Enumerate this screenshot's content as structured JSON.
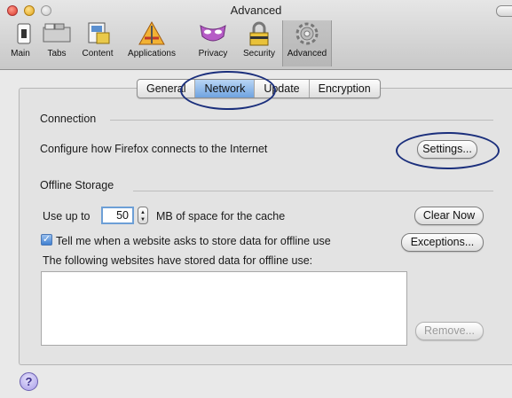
{
  "window": {
    "title": "Advanced"
  },
  "toolbar": {
    "items": [
      {
        "label": "Main",
        "icon": "main-switch-icon"
      },
      {
        "label": "Tabs",
        "icon": "tabs-icon"
      },
      {
        "label": "Content",
        "icon": "content-icon"
      },
      {
        "label": "Applications",
        "icon": "applications-icon"
      },
      {
        "label": "Privacy",
        "icon": "privacy-mask-icon"
      },
      {
        "label": "Security",
        "icon": "security-padlock-icon"
      },
      {
        "label": "Advanced",
        "icon": "advanced-gear-icon"
      }
    ],
    "selected": "Advanced"
  },
  "tabs": [
    {
      "label": "General"
    },
    {
      "label": "Network",
      "active": true
    },
    {
      "label": "Update"
    },
    {
      "label": "Encryption"
    }
  ],
  "connection": {
    "header": "Connection",
    "description": "Configure how Firefox connects to the Internet",
    "settings_button": "Settings..."
  },
  "offline": {
    "header": "Offline Storage",
    "use_up_to": "Use up to",
    "cache_value": "50",
    "cache_suffix": "MB of space for the cache",
    "clear_now_button": "Clear Now",
    "tell_me_checkbox": "Tell me when a website asks to store data for offline use",
    "tell_me_checked": true,
    "exceptions_button": "Exceptions...",
    "stored_label": "The following websites have stored data for offline use:",
    "stored_sites": [],
    "remove_button": "Remove..."
  },
  "help": {
    "label": "?"
  },
  "colors": {
    "accent": "#6fa3e0",
    "annotation": "#1b2f7c"
  }
}
